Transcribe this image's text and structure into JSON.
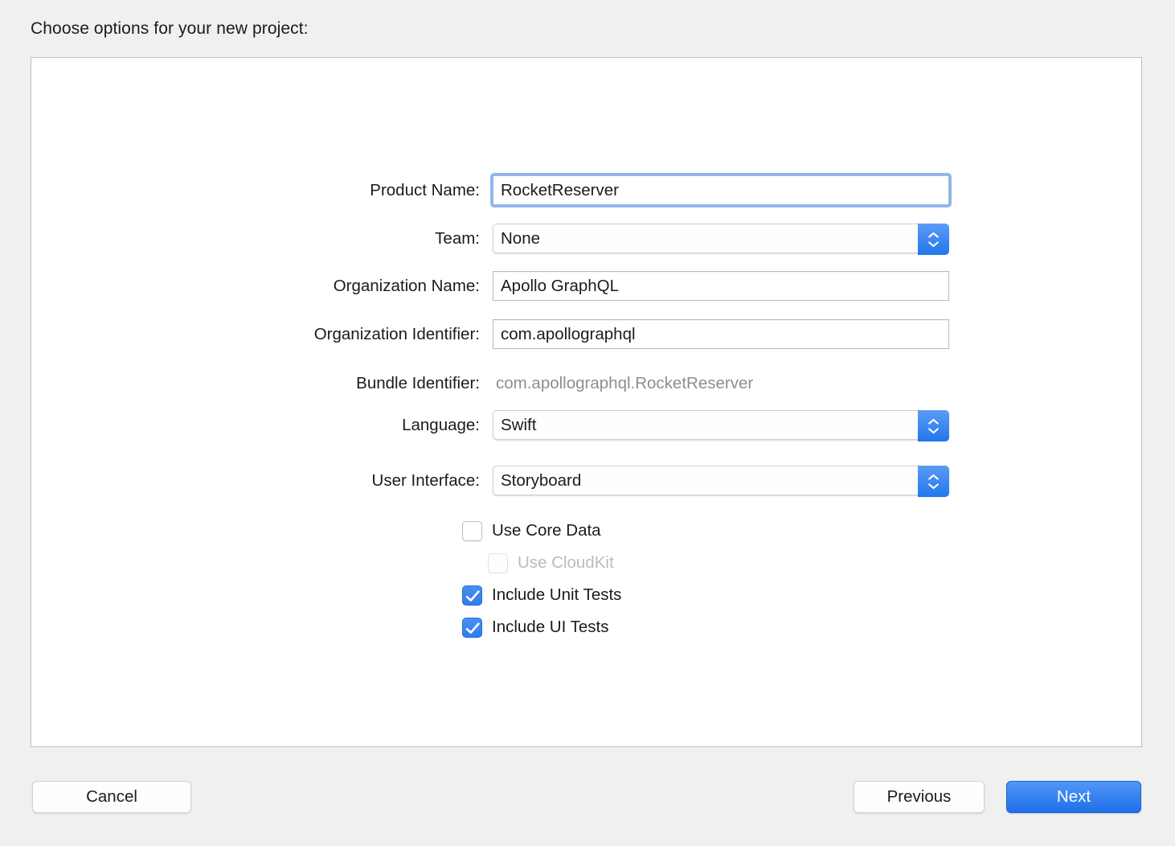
{
  "dialog": {
    "title": "Choose options for your new project:"
  },
  "form": {
    "fields": [
      {
        "label": "Product Name:",
        "value": "RocketReserver",
        "kind": "textfield",
        "focused": true
      },
      {
        "label": "Team:",
        "value": "None",
        "kind": "popup"
      },
      {
        "label": "Organization Name:",
        "value": "Apollo GraphQL",
        "kind": "textfield"
      },
      {
        "label": "Organization Identifier:",
        "value": "com.apollographql",
        "kind": "textfield"
      },
      {
        "label": "Bundle Identifier:",
        "value": "com.apollographql.RocketReserver",
        "kind": "static"
      },
      {
        "label": "Language:",
        "value": "Swift",
        "kind": "popup"
      },
      {
        "label": "User Interface:",
        "value": "Storyboard",
        "kind": "popup"
      }
    ],
    "checkboxes": [
      {
        "label": "Use Core Data",
        "checked": false,
        "disabled": false,
        "indented": false
      },
      {
        "label": "Use CloudKit",
        "checked": false,
        "disabled": true,
        "indented": true
      },
      {
        "label": "Include Unit Tests",
        "checked": true,
        "disabled": false,
        "indented": false
      },
      {
        "label": "Include UI Tests",
        "checked": true,
        "disabled": false,
        "indented": false
      }
    ]
  },
  "footer": {
    "cancel_label": "Cancel",
    "previous_label": "Previous",
    "next_label": "Next"
  },
  "colors": {
    "accent_blue": "#2f7cf0",
    "focus_ring": "#8fb6ee",
    "window_background": "#f0f0f0",
    "panel_background": "#ffffff",
    "panel_border": "#bfbfbf",
    "disabled_text": "#bcbcbc",
    "static_text": "#8e8e8e"
  }
}
